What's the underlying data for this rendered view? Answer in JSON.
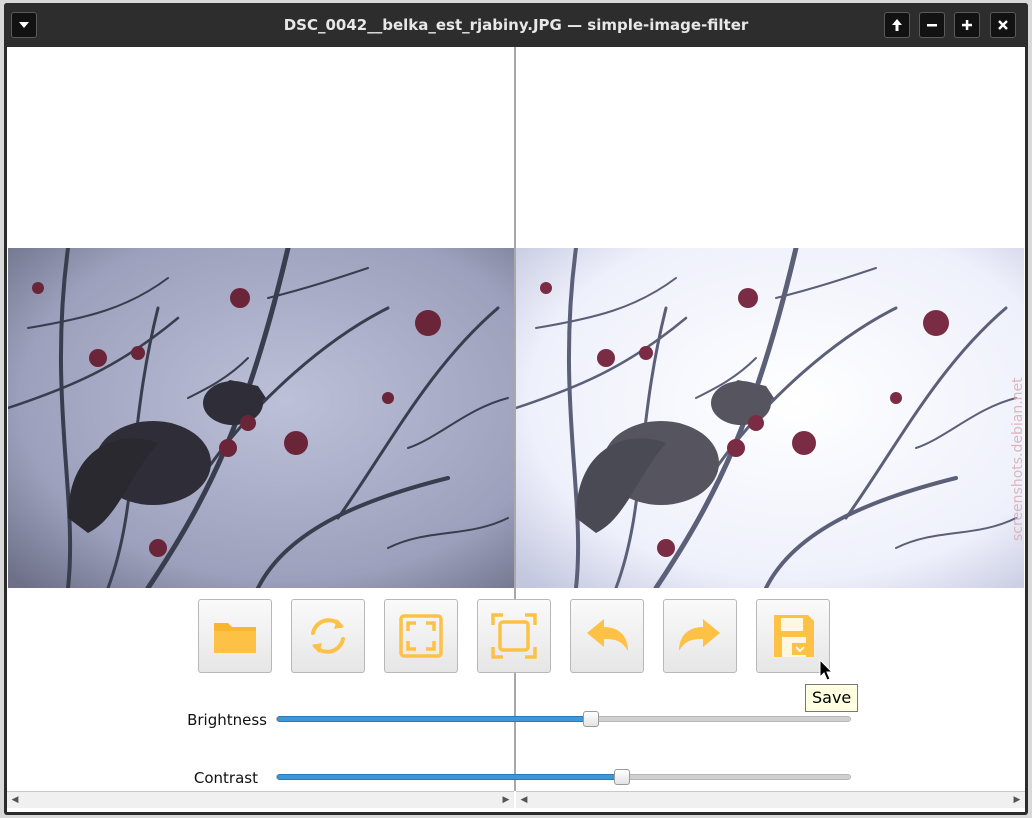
{
  "window": {
    "title": "DSC_0042__belka_est_rjabiny.JPG — simple-image-filter",
    "menu_icon": "chevron-down-icon",
    "controls": [
      "arrow-up-icon",
      "minimize-icon",
      "maximize-icon",
      "close-icon"
    ]
  },
  "toolbar": {
    "buttons": [
      {
        "icon": "folder-open-icon"
      },
      {
        "icon": "refresh-icon"
      },
      {
        "icon": "fit-window-icon"
      },
      {
        "icon": "zoom-fit-icon"
      },
      {
        "icon": "undo-icon"
      },
      {
        "icon": "redo-icon"
      },
      {
        "icon": "save-icon"
      }
    ],
    "tooltip": "Save",
    "icon_color": "#fdc145"
  },
  "sliders": {
    "brightness": {
      "label": "Brightness",
      "value_fraction": 0.548
    },
    "contrast": {
      "label": "Contrast",
      "value_fraction": 0.602
    }
  },
  "watermark": "screenshots.debian.net",
  "colors": {
    "titlebar": "#2d2d2d",
    "slider_fill": "#3d97d8",
    "tooltip_bg": "#ffffe1"
  }
}
